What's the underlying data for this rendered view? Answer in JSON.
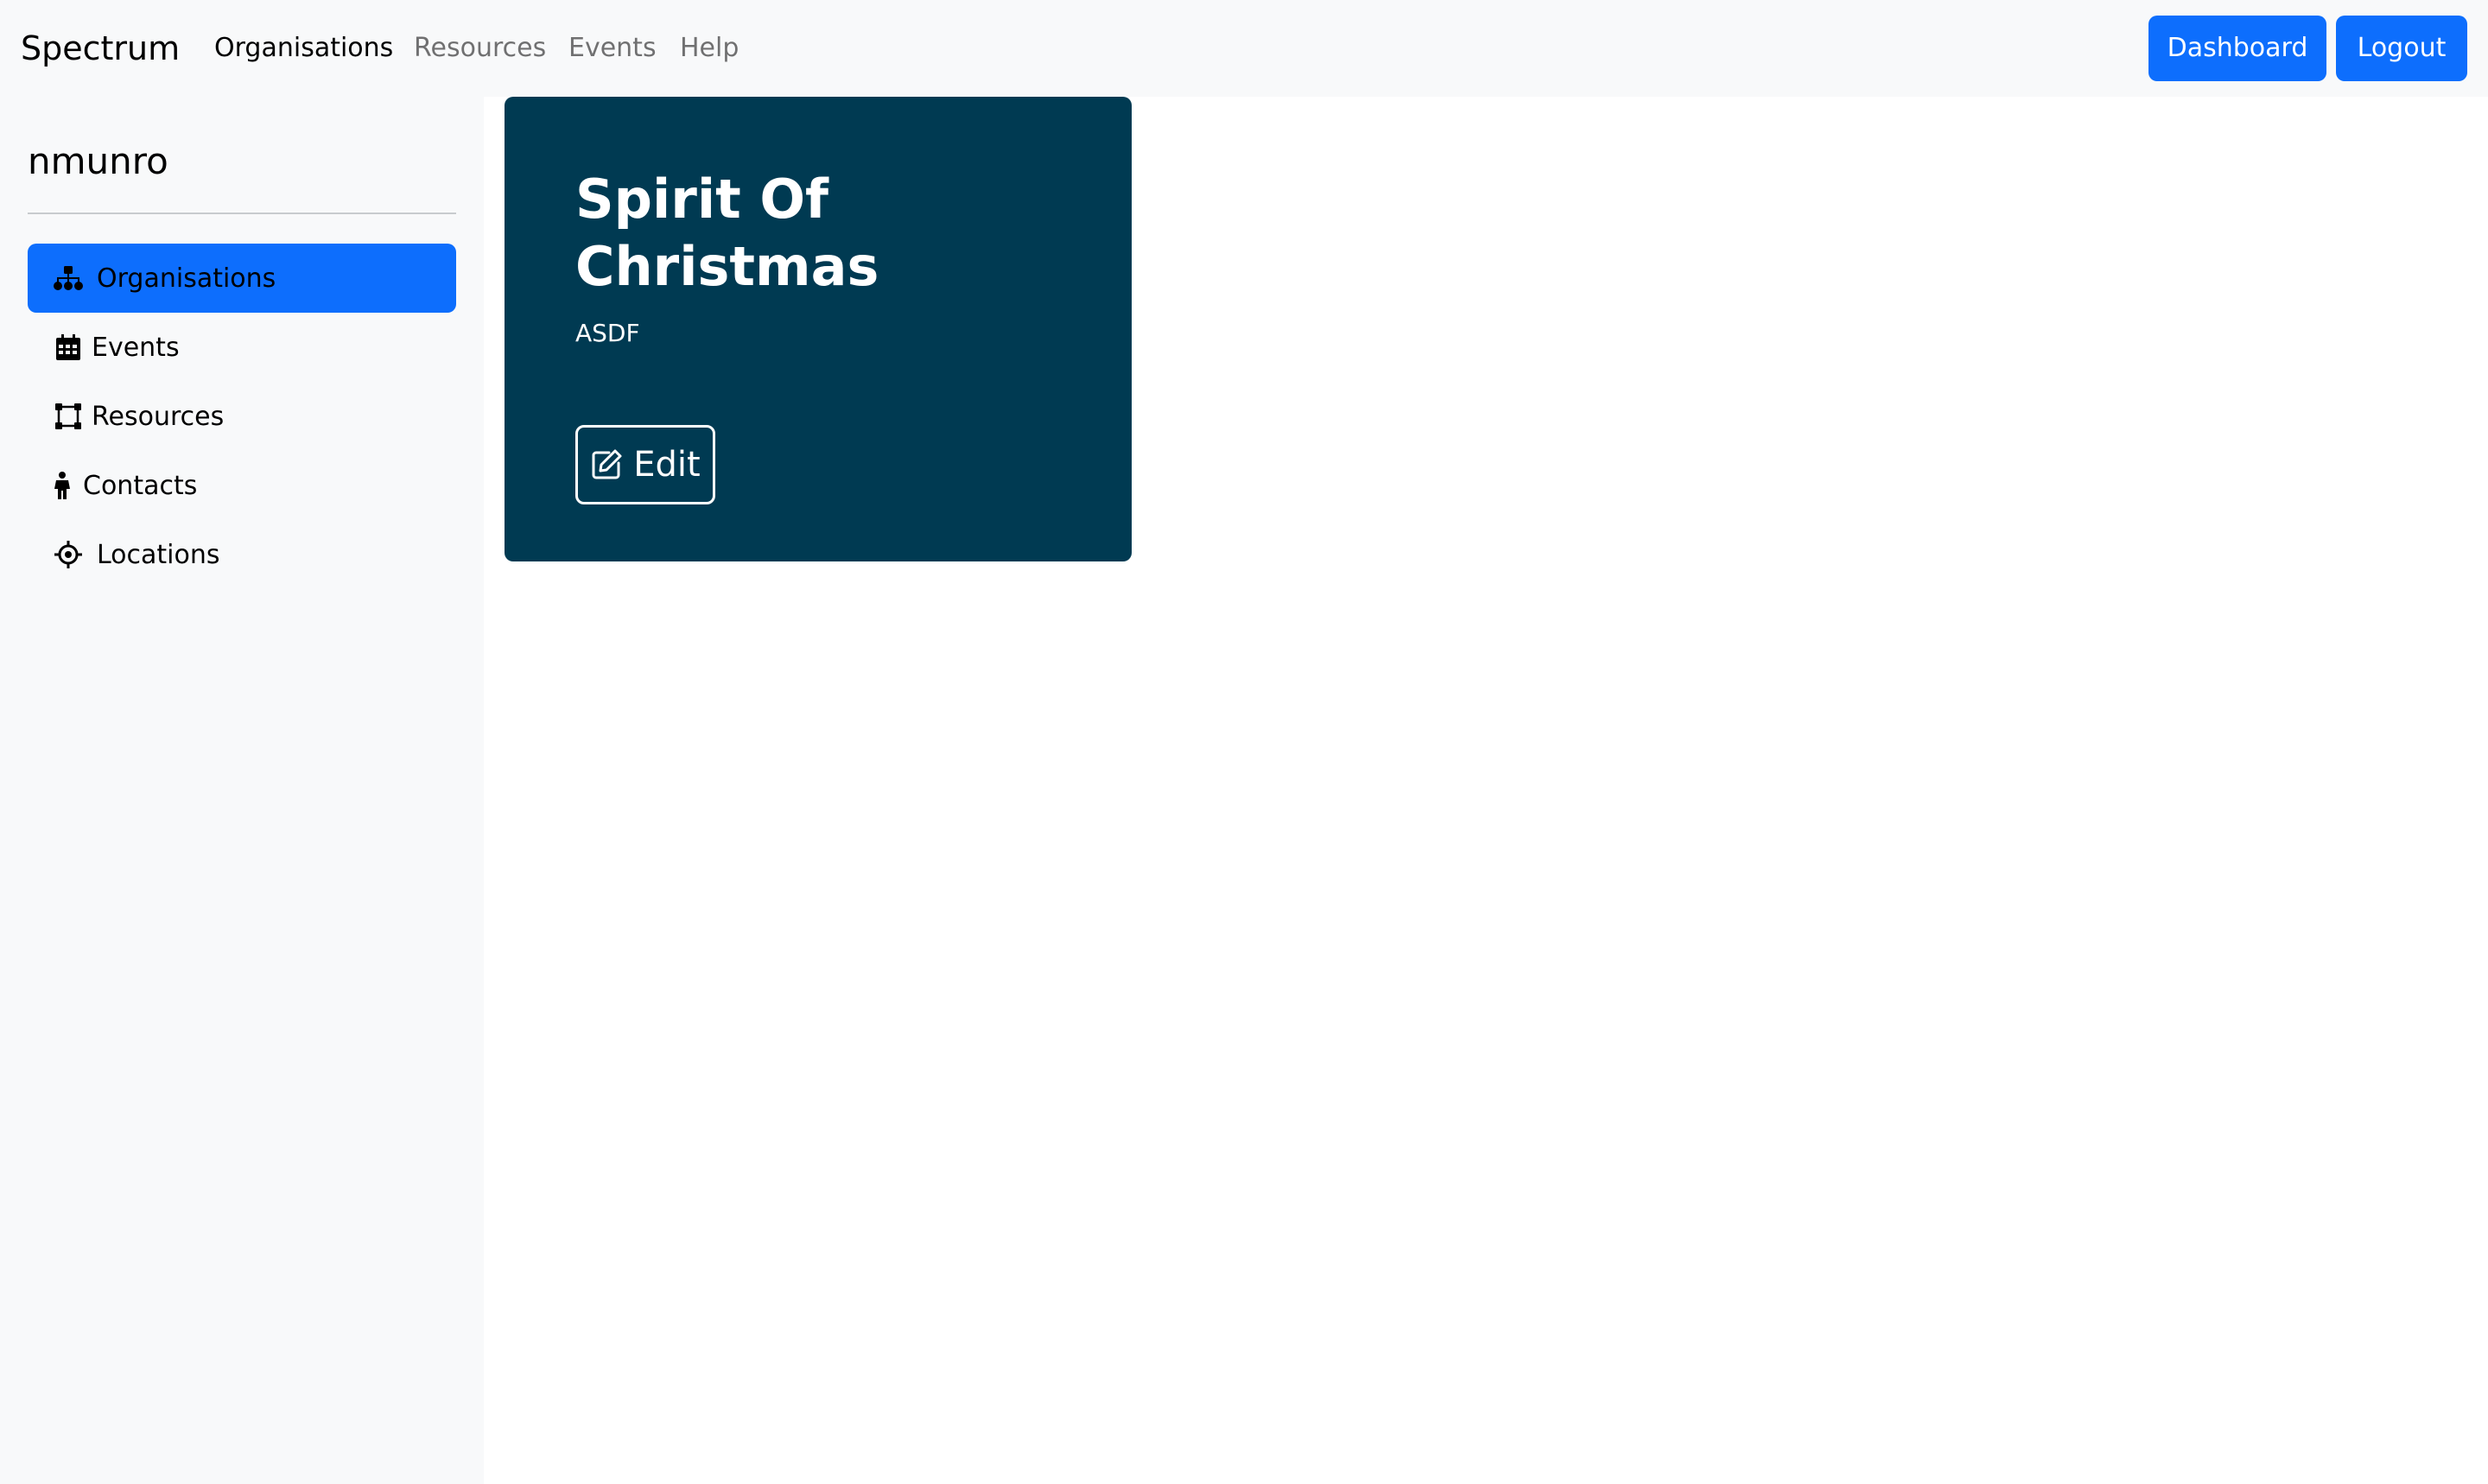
{
  "navbar": {
    "brand": "Spectrum",
    "links": [
      "Organisations",
      "Resources",
      "Events",
      "Help"
    ],
    "active_link": "Organisations",
    "buttons": {
      "dashboard": "Dashboard",
      "logout": "Logout"
    }
  },
  "sidebar": {
    "username": "nmunro",
    "items": [
      {
        "label": "Organisations",
        "icon": "sitemap-icon",
        "active": true
      },
      {
        "label": "Events",
        "icon": "calendar-icon",
        "active": false
      },
      {
        "label": "Resources",
        "icon": "vector-square-icon",
        "active": false
      },
      {
        "label": "Contacts",
        "icon": "person-icon",
        "active": false
      },
      {
        "label": "Locations",
        "icon": "crosshairs-icon",
        "active": false
      }
    ]
  },
  "card": {
    "title": "Spirit Of Christmas",
    "subtitle": "ASDF",
    "edit_label": "Edit"
  },
  "colors": {
    "primary": "#0d6efd",
    "card_bg": "#003a52",
    "nav_bg": "#f8f9fa"
  }
}
